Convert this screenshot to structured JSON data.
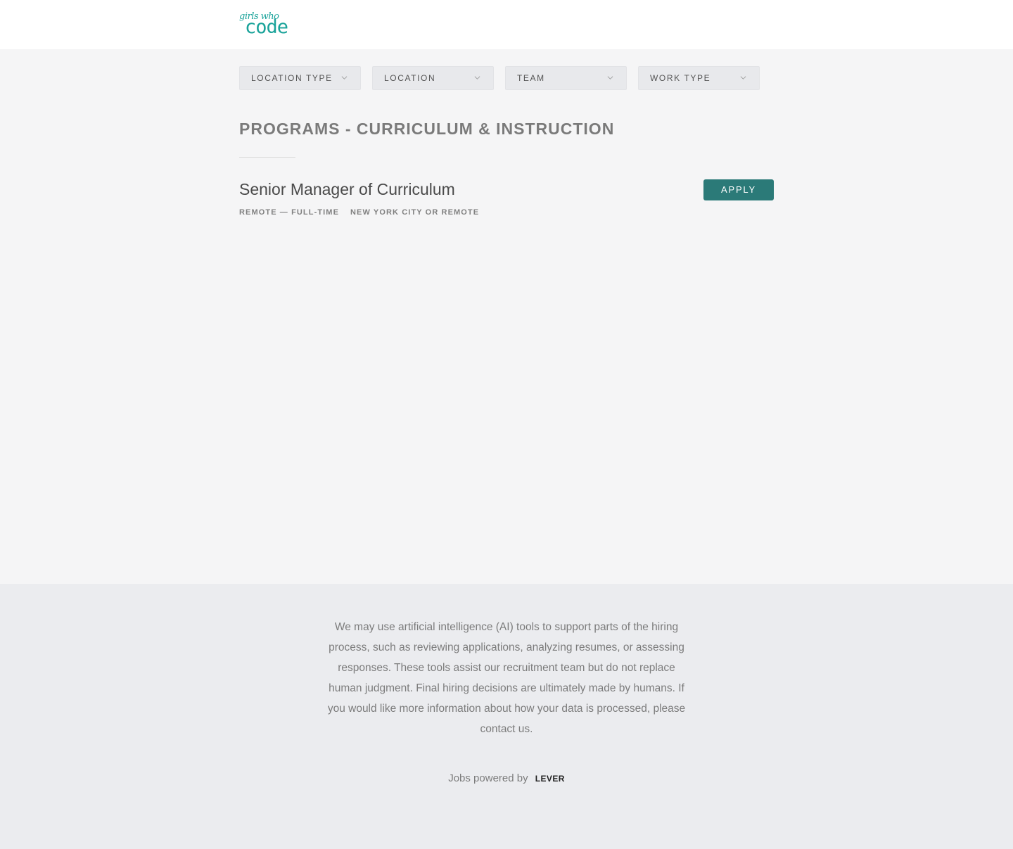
{
  "brand": {
    "logo_small": "girls who",
    "logo_big": "code",
    "color": "#1aa39a"
  },
  "filters": [
    {
      "label": "LOCATION TYPE"
    },
    {
      "label": "LOCATION"
    },
    {
      "label": "TEAM"
    },
    {
      "label": "WORK TYPE"
    }
  ],
  "section": {
    "title": "PROGRAMS - CURRICULUM & INSTRUCTION"
  },
  "job": {
    "title": "Senior Manager of Curriculum",
    "work_type": "REMOTE — FULL-TIME",
    "location": "NEW YORK CITY OR REMOTE",
    "apply_label": "APPLY",
    "apply_color": "#2b7a78"
  },
  "footer": {
    "disclaimer": "We may use artificial intelligence (AI) tools to support parts of the hiring process, such as reviewing applications, analyzing resumes, or assessing responses. These tools assist our recruitment team but do not replace human judgment. Final hiring decisions are ultimately made by humans. If you would like more information about how your data is processed, please contact us.",
    "powered_by": "Jobs powered by",
    "lever": "LEVER"
  },
  "icons": {
    "filter_chevron": "chevron-down-icon"
  }
}
